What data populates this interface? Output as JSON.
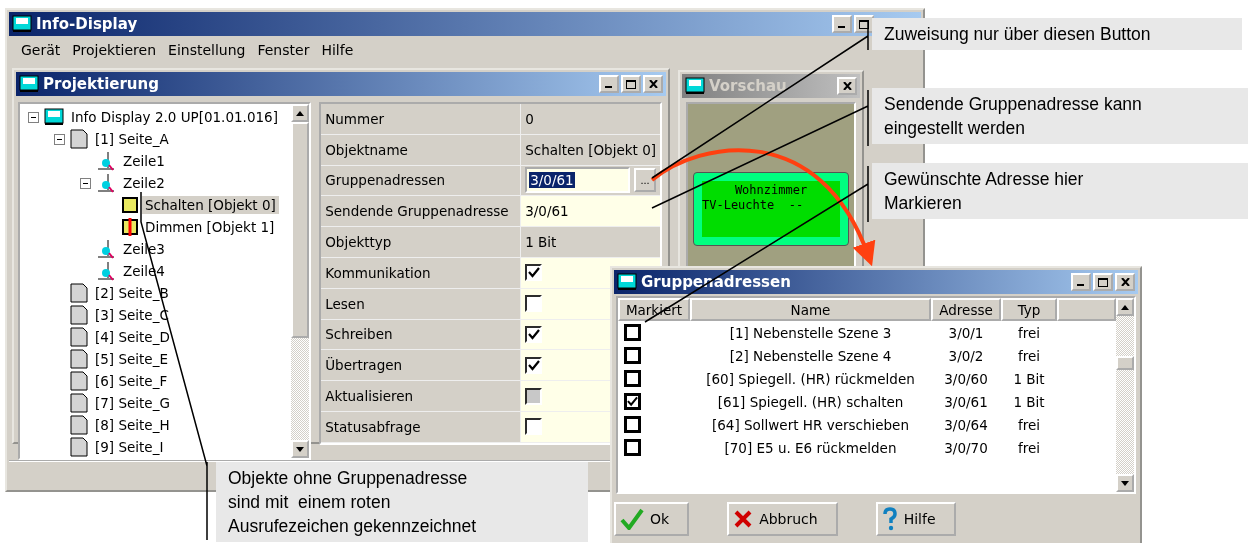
{
  "main_window": {
    "title": "Info-Display",
    "menu": [
      "Gerät",
      "Projektieren",
      "Einstellung",
      "Fenster",
      "Hilfe"
    ]
  },
  "projektierung": {
    "title": "Projektierung",
    "tree": [
      {
        "kind": "device",
        "label": "Info Display 2.0 UP[01.01.016]",
        "expanded": true,
        "selected": false,
        "children": [
          {
            "kind": "page",
            "label": "[1] Seite_A",
            "expanded": true,
            "selected": false,
            "children": [
              {
                "kind": "line",
                "label": "Zeile1",
                "selected": false
              },
              {
                "kind": "line",
                "label": "Zeile2",
                "expanded": true,
                "selected": false,
                "children": [
                  {
                    "kind": "object",
                    "label": "Schalten [Objekt 0]",
                    "selected": true,
                    "missing_address": false
                  },
                  {
                    "kind": "object",
                    "label": "Dimmen [Objekt 1]",
                    "selected": false,
                    "missing_address": true
                  }
                ]
              },
              {
                "kind": "line",
                "label": "Zeile3",
                "selected": false
              },
              {
                "kind": "line",
                "label": "Zeile4",
                "selected": false
              }
            ]
          },
          {
            "kind": "page",
            "label": "[2] Seite_B",
            "selected": false
          },
          {
            "kind": "page",
            "label": "[3] Seite_C",
            "selected": false
          },
          {
            "kind": "page",
            "label": "[4] Seite_D",
            "selected": false
          },
          {
            "kind": "page",
            "label": "[5] Seite_E",
            "selected": false
          },
          {
            "kind": "page",
            "label": "[6] Seite_F",
            "selected": false
          },
          {
            "kind": "page",
            "label": "[7] Seite_G",
            "selected": false
          },
          {
            "kind": "page",
            "label": "[8] Seite_H",
            "selected": false
          },
          {
            "kind": "page",
            "label": "[9] Seite_I",
            "selected": false
          }
        ]
      }
    ],
    "properties": [
      {
        "kind": "text",
        "label": "Nummer",
        "value": "0"
      },
      {
        "kind": "text",
        "label": "Objektname",
        "value": "Schalten [Objekt 0]"
      },
      {
        "kind": "picker",
        "label": "Gruppenadressen",
        "value": "3/0/61",
        "button": "..."
      },
      {
        "kind": "edit",
        "label": "Sendende Gruppenadresse",
        "value": "3/0/61"
      },
      {
        "kind": "text",
        "label": "Objekttyp",
        "value": "1 Bit"
      },
      {
        "kind": "checkbox",
        "label": "Kommunikation",
        "checked": true,
        "disabled": false
      },
      {
        "kind": "checkbox",
        "label": "Lesen",
        "checked": false,
        "disabled": false
      },
      {
        "kind": "checkbox",
        "label": "Schreiben",
        "checked": true,
        "disabled": false
      },
      {
        "kind": "checkbox",
        "label": "Übertragen",
        "checked": true,
        "disabled": false
      },
      {
        "kind": "checkbox",
        "label": "Aktualisieren",
        "checked": false,
        "disabled": true
      },
      {
        "kind": "checkbox",
        "label": "Statusabfrage",
        "checked": false,
        "disabled": false
      }
    ]
  },
  "vorschau": {
    "title": "Vorschau",
    "lcd_lines": [
      "Wohnzimmer",
      "TV-Leuchte  --"
    ]
  },
  "gruppenadressen": {
    "title": "Gruppenadressen",
    "columns": [
      "Markiert",
      "Name",
      "Adresse",
      "Typ"
    ],
    "rows": [
      {
        "checked": false,
        "name": "[1] Nebenstelle Szene 3",
        "address": "3/0/1",
        "type": "frei"
      },
      {
        "checked": false,
        "name": "[2] Nebenstelle Szene 4",
        "address": "3/0/2",
        "type": "frei"
      },
      {
        "checked": false,
        "name": "[60] Spiegell. (HR)  rückmelden",
        "address": "3/0/60",
        "type": "1 Bit"
      },
      {
        "checked": true,
        "name": "[61] Spiegell. (HR) schalten",
        "address": "3/0/61",
        "type": "1 Bit"
      },
      {
        "checked": false,
        "name": "[64] Sollwert HR  verschieben",
        "address": "3/0/64",
        "type": "frei"
      },
      {
        "checked": false,
        "name": "[70] E5 u. E6 rückmelden",
        "address": "3/0/70",
        "type": "frei"
      }
    ],
    "buttons": [
      {
        "kind": "ok",
        "label": "Ok"
      },
      {
        "kind": "cancel",
        "label": "Abbruch"
      },
      {
        "kind": "help",
        "label": "Hilfe"
      }
    ]
  },
  "callouts": [
    {
      "text": "Zuweisung nur über diesen Button"
    },
    {
      "text": "Sendende Gruppenadresse kann\neingestellt werden"
    },
    {
      "text": "Gewünschte Adresse hier\nMarkieren"
    },
    {
      "text": "Objekte ohne Gruppenadresse\nsind mit  einem roten\nAusrufezeichen gekennzeichnet"
    }
  ]
}
